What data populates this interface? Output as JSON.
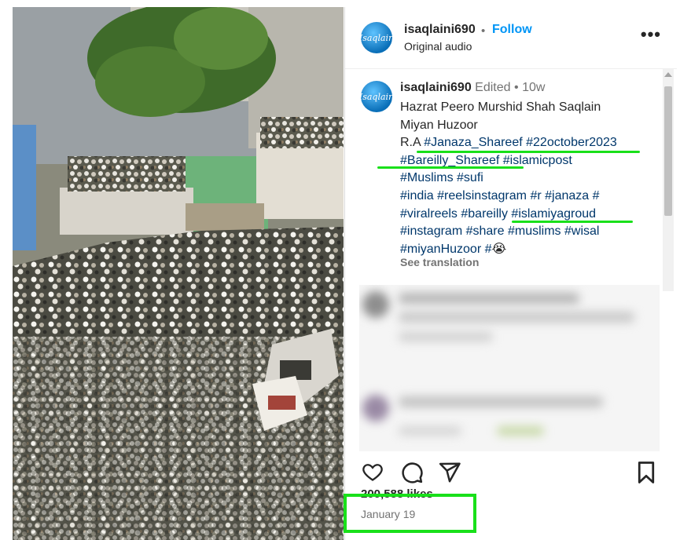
{
  "post": {
    "username": "isaqlaini690",
    "separator": "•",
    "follow_label": "Follow",
    "audio_label": "Original audio",
    "more_label": "•••",
    "avatar_text": "Isaqlain",
    "caption": {
      "edited": "Edited",
      "time": "10w",
      "line1": "Hazrat Peero Murshid Shah Saqlain",
      "line2": "Miyan Huzoor",
      "line3_prefix": "R.A ",
      "tag_janaza_shareef": "#Janaza_Shareef",
      "tag_date": "#22october2023",
      "tag_bareilly_shareef": "#Bareilly_Shareef",
      "tag_islamicpost": "#islamicpost",
      "tag_muslims": "#Muslims",
      "tag_sufi": "#sufi",
      "tag_india": "#india",
      "tag_reelsinstagram": "#reelsinstagram",
      "tag_r": "#r",
      "tag_janaza": "#janaza",
      "tag_hash": "#",
      "tag_viralreels": "#viralreels",
      "tag_bareilly": "#bareilly",
      "tag_islamiyagroud": "#islamiyagroud",
      "tag_instagram": "#instagram",
      "tag_share": "#share",
      "tag_muslims2": "#muslims",
      "tag_wisal": "#wisal",
      "tag_miyanhuzoor": "#miyanHuzoor",
      "tag_emoji_prefix": "#",
      "emoji": "😭",
      "see_translation": "See translation"
    },
    "likes": "200,588 likes",
    "date": "January 19"
  }
}
